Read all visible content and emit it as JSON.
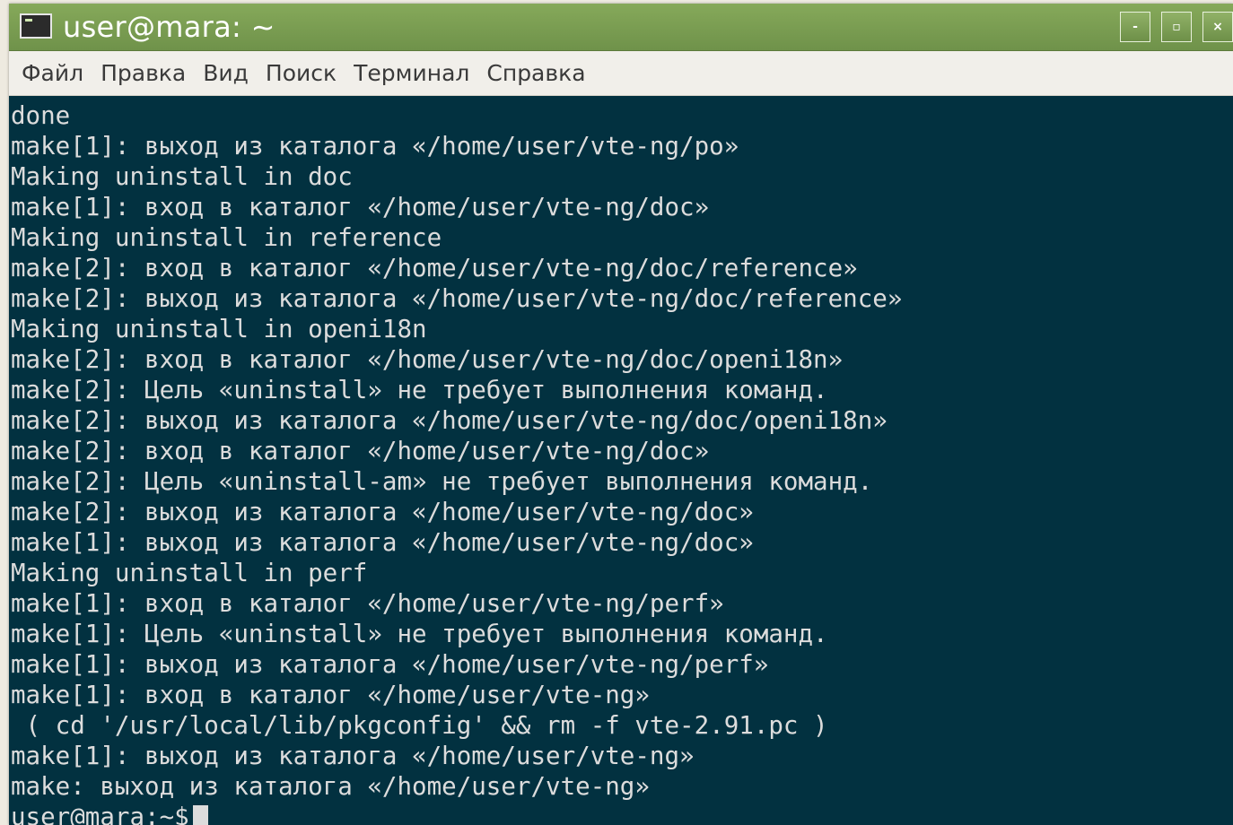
{
  "window": {
    "title": "user@mara: ~",
    "icon": "terminal-icon",
    "controls": {
      "minimize": "-",
      "maximize": "▫",
      "close": "×"
    }
  },
  "menu": [
    "Файл",
    "Правка",
    "Вид",
    "Поиск",
    "Терминал",
    "Справка"
  ],
  "terminal": {
    "lines": [
      "done",
      "make[1]: выход из каталога «/home/user/vte-ng/po»",
      "Making uninstall in doc",
      "make[1]: вход в каталог «/home/user/vte-ng/doc»",
      "Making uninstall in reference",
      "make[2]: вход в каталог «/home/user/vte-ng/doc/reference»",
      "make[2]: выход из каталога «/home/user/vte-ng/doc/reference»",
      "Making uninstall in openi18n",
      "make[2]: вход в каталог «/home/user/vte-ng/doc/openi18n»",
      "make[2]: Цель «uninstall» не требует выполнения команд.",
      "make[2]: выход из каталога «/home/user/vte-ng/doc/openi18n»",
      "make[2]: вход в каталог «/home/user/vte-ng/doc»",
      "make[2]: Цель «uninstall-am» не требует выполнения команд.",
      "make[2]: выход из каталога «/home/user/vte-ng/doc»",
      "make[1]: выход из каталога «/home/user/vte-ng/doc»",
      "Making uninstall in perf",
      "make[1]: вход в каталог «/home/user/vte-ng/perf»",
      "make[1]: Цель «uninstall» не требует выполнения команд.",
      "make[1]: выход из каталога «/home/user/vte-ng/perf»",
      "make[1]: вход в каталог «/home/user/vte-ng»",
      " ( cd '/usr/local/lib/pkgconfig' && rm -f vte-2.91.pc )",
      "make[1]: выход из каталога «/home/user/vte-ng»",
      "make: выход из каталога «/home/user/vte-ng»"
    ],
    "prompt": "user@mara:~$",
    "colors": {
      "background": "#023140",
      "foreground": "#dcdcdc"
    }
  },
  "colors": {
    "titlebar": "#7b9e52",
    "menubar": "#f1efea"
  }
}
